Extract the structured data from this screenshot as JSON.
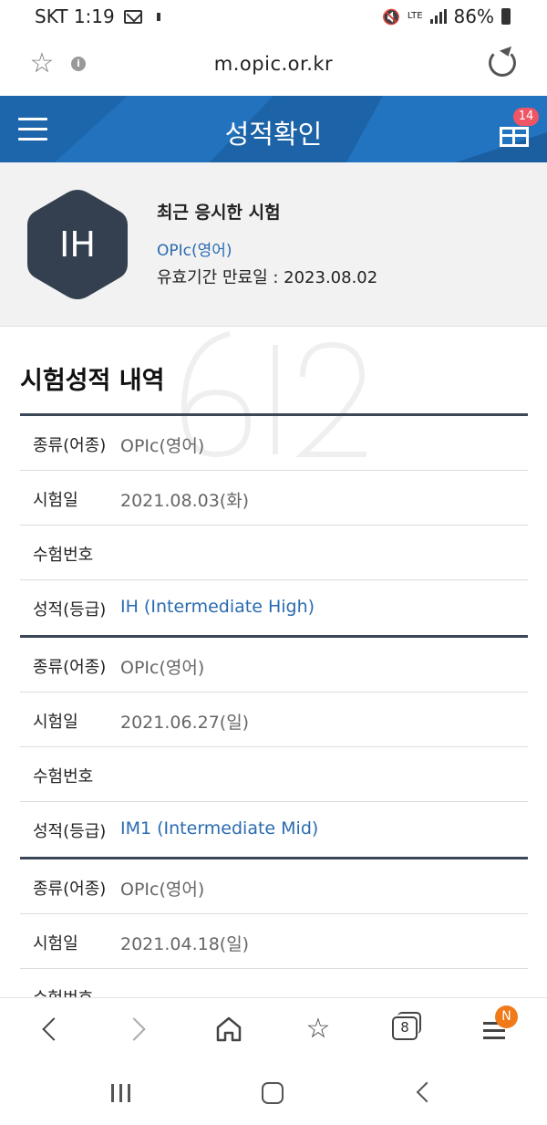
{
  "status_bar": {
    "carrier_time": "SKT 1:19",
    "network": "LTE",
    "battery": "86%"
  },
  "address_bar": {
    "url": "m.opic.or.kr"
  },
  "header": {
    "title": "성적확인",
    "gift_badge": "14",
    "brand_color": "#1f6cb5"
  },
  "profile": {
    "grade_short": "IH",
    "recent_title": "최근 응시한 시험",
    "exam_type": "OPIc(영어)",
    "valid_until": "유효기간 만료일 : 2023.08.02"
  },
  "section": {
    "title": "시험성적 내역"
  },
  "records": [
    {
      "rows": [
        {
          "label": "종류(어종)",
          "value": "OPIc(영어)"
        },
        {
          "label": "시험일",
          "value": "2021.08.03(화)"
        },
        {
          "label": "수험번호",
          "value": ""
        },
        {
          "label": "성적(등급)",
          "value": "IH (Intermediate High)"
        }
      ]
    },
    {
      "rows": [
        {
          "label": "종류(어종)",
          "value": "OPIc(영어)"
        },
        {
          "label": "시험일",
          "value": "2021.06.27(일)"
        },
        {
          "label": "수험번호",
          "value": ""
        },
        {
          "label": "성적(등급)",
          "value": "IM1 (Intermediate Mid)"
        }
      ]
    },
    {
      "rows": [
        {
          "label": "종류(어종)",
          "value": "OPIc(영어)"
        },
        {
          "label": "시험일",
          "value": "2021.04.18(일)"
        },
        {
          "label": "수험번호",
          "value": ""
        }
      ]
    }
  ],
  "toolbar": {
    "tabs_count": "8",
    "menu_badge": "N"
  }
}
